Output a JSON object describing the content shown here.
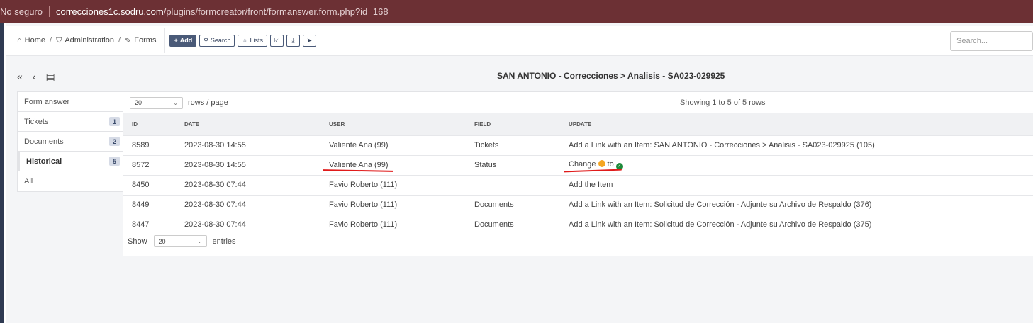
{
  "browser": {
    "security_label": "No seguro",
    "url_host": "correcciones1c.sodru.com",
    "url_path": "/plugins/formcreator/front/formanswer.form.php?id=168"
  },
  "breadcrumb": {
    "home": "Home",
    "administration": "Administration",
    "forms": "Forms"
  },
  "toolbar": {
    "add_label": "Add",
    "search_label": "Search",
    "lists_label": "Lists"
  },
  "global_search": {
    "placeholder": "Search..."
  },
  "page_title": "SAN ANTONIO - Correcciones > Analisis - SA023-029925",
  "tabs": [
    {
      "label": "Form answer",
      "count": null
    },
    {
      "label": "Tickets",
      "count": "1"
    },
    {
      "label": "Documents",
      "count": "2"
    },
    {
      "label": "Historical",
      "count": "5"
    },
    {
      "label": "All",
      "count": null
    }
  ],
  "pager": {
    "rows_value": "20",
    "rows_label": "rows / page",
    "showing": "Showing 1 to 5 of 5 rows"
  },
  "table": {
    "columns": [
      "ID",
      "DATE",
      "USER",
      "FIELD",
      "UPDATE"
    ],
    "rows": [
      {
        "id": "8589",
        "date": "2023-08-30 14:55",
        "user": "Valiente Ana (99)",
        "field": "Tickets",
        "update": "Add a Link with an Item: SAN ANTONIO - Correcciones > Analisis - SA023-029925 (105)"
      },
      {
        "id": "8572",
        "date": "2023-08-30 14:55",
        "user": "Valiente Ana (99)",
        "field": "Status",
        "update_prefix": "Change",
        "update_mid": "to"
      },
      {
        "id": "8450",
        "date": "2023-08-30 07:44",
        "user": "Favio Roberto (111)",
        "field": "",
        "update": "Add the Item"
      },
      {
        "id": "8449",
        "date": "2023-08-30 07:44",
        "user": "Favio Roberto (111)",
        "field": "Documents",
        "update": "Add a Link with an Item: Solicitud de Corrección - Adjunte su Archivo de Respaldo (376)"
      },
      {
        "id": "8447",
        "date": "2023-08-30 07:44",
        "user": "Favio Roberto (111)",
        "field": "Documents",
        "update": "Add a Link with an Item: Solicitud de Corrección - Adjunte su Archivo de Respaldo (375)"
      }
    ]
  },
  "footer": {
    "show_label": "Show",
    "entries_value": "20",
    "entries_label": "entries"
  },
  "colors": {
    "status_from": "#f5a623",
    "status_to": "#1e8a3a",
    "annotation": "#e01b1b"
  },
  "icons": [
    "home-icon",
    "shield-icon",
    "edit-icon",
    "plus-icon",
    "search-icon",
    "star-icon",
    "checkbox-icon",
    "download-icon",
    "send-icon",
    "double-chevron-left-icon",
    "chevron-left-icon",
    "list-icon",
    "chevron-down-icon",
    "check-icon"
  ]
}
